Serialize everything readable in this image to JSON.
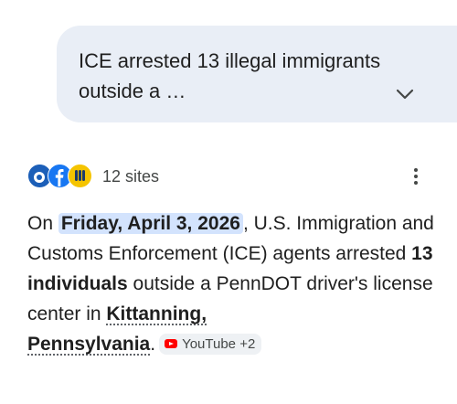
{
  "query": {
    "text": "ICE arrested 13 illegal immigrants outside a …",
    "expand_icon": "chevron-down-icon"
  },
  "sources": {
    "count_label": "12 sites",
    "favicons": [
      "action-news-icon",
      "facebook-icon",
      "pbs-icon"
    ],
    "menu_icon": "more-vert-icon"
  },
  "answer": {
    "p1": "On ",
    "date": "Friday, April 3, 2026",
    "p2": ", U.S. Immigration and Customs Enforcement (ICE) agents arrested ",
    "count": "13 individuals",
    "p3": " outside a PennDOT driver's license center in ",
    "place1": "Kittanning,",
    "space": " ",
    "place2": "Pennsylvania",
    "p4": ".",
    "chip_label": "YouTube +2"
  },
  "colors": {
    "bubble": "#e9eef6",
    "highlight": "#d3e3fd",
    "chip": "#eef1f4",
    "youtube": "#ff0000"
  }
}
